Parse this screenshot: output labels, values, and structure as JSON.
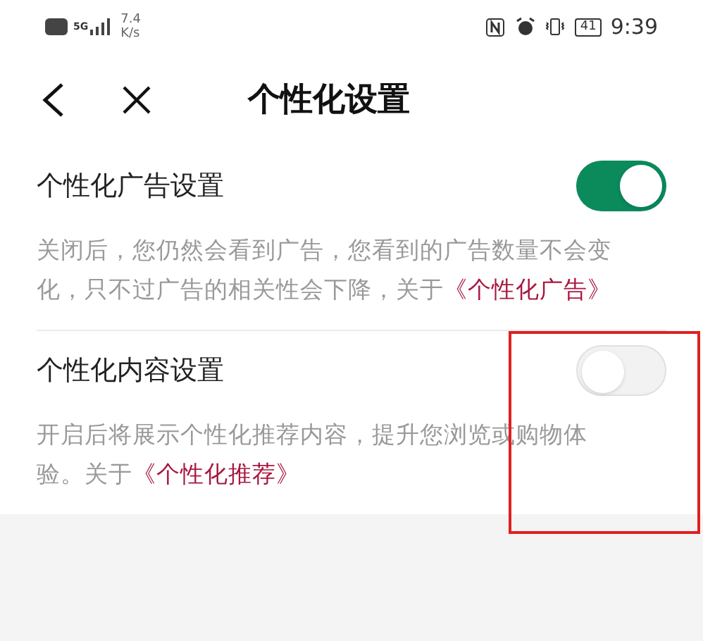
{
  "status_bar": {
    "network_label": "5G",
    "speed_value": "7.4",
    "speed_unit": "K/s",
    "battery": "41",
    "time": "9:39"
  },
  "header": {
    "title": "个性化设置"
  },
  "settings": [
    {
      "label": "个性化广告设置",
      "on": true,
      "description": "关闭后，您仍然会看到广告，您看到的广告数量不会变化，只不过广告的相关性会下降，关于",
      "link": "《个性化广告》",
      "highlighted": false
    },
    {
      "label": "个性化内容设置",
      "on": false,
      "description": "开启后将展示个性化推荐内容，提升您浏览或购物体验。关于",
      "link": "《个性化推荐》",
      "highlighted": true
    }
  ]
}
